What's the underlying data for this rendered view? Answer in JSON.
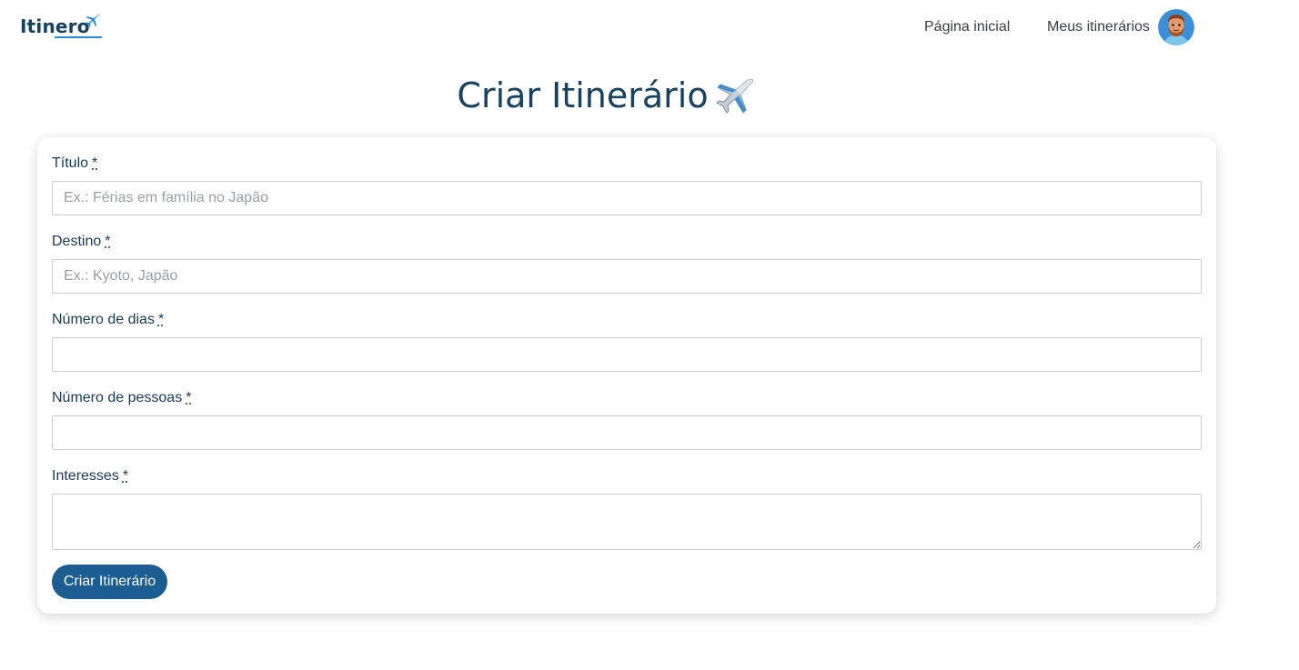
{
  "header": {
    "logo_text": "Itinero",
    "nav": {
      "home_label": "Página inicial",
      "my_itineraries_label": "Meus itinerários"
    }
  },
  "page": {
    "title": "Criar Itinerário"
  },
  "form": {
    "required_mark": "*",
    "fields": [
      {
        "label": "Título",
        "placeholder": "Ex.: Férias em família no Japão",
        "value": ""
      },
      {
        "label": "Destino",
        "placeholder": "Ex.: Kyoto, Japão",
        "value": ""
      },
      {
        "label": "Número de dias",
        "placeholder": "",
        "value": ""
      },
      {
        "label": "Número de pessoas",
        "placeholder": "",
        "value": ""
      },
      {
        "label": "Interesses",
        "placeholder": "",
        "value": ""
      }
    ],
    "submit_label": "Criar Itinerário"
  },
  "colors": {
    "brand_dark": "#16425f",
    "button": "#1d5e92",
    "accent_blue": "#2b8bd6"
  },
  "icons": {
    "logo_plane": "airplane-icon",
    "title_plane": "airplane-emoji-icon",
    "avatar": "user-avatar"
  }
}
